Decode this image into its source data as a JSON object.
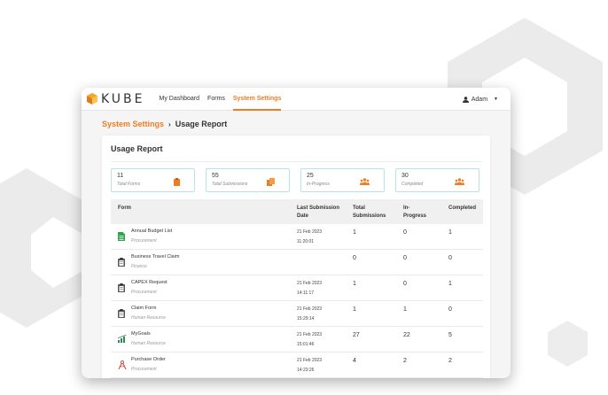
{
  "colors": {
    "accent": "#ef7c22",
    "hex_bg": "#ededed",
    "stat_border": "#b6e3ea"
  },
  "navbar": {
    "logo_text": "KUBE",
    "items": [
      "My Dashboard",
      "Forms",
      "System Settings"
    ],
    "active_item": "System Settings",
    "user": "Adam"
  },
  "breadcrumb": {
    "parent": "System Settings",
    "separator": "›",
    "current": "Usage Report"
  },
  "report": {
    "title": "Usage Report",
    "stats": [
      {
        "value": "11",
        "label": "Total Forms",
        "icon": "clipboard-icon"
      },
      {
        "value": "55",
        "label": "Total Submissions",
        "icon": "documents-icon"
      },
      {
        "value": "25",
        "label": "In-Progress",
        "icon": "users-icon"
      },
      {
        "value": "30",
        "label": "Completed",
        "icon": "users-icon"
      }
    ],
    "columns": [
      "Form",
      "Last Submission Date",
      "Total Submissions",
      "In-Progress",
      "Completed"
    ],
    "rows": [
      {
        "name": "Annual Budget List",
        "category": "Procurement",
        "date": "21 Feb 2023",
        "time": "11:20:01",
        "total": "1",
        "in_progress": "0",
        "completed": "1",
        "icon": "spreadsheet-icon"
      },
      {
        "name": "Business Travel Claim",
        "category": "Finance",
        "date": "",
        "time": "",
        "total": "0",
        "in_progress": "0",
        "completed": "0",
        "icon": "clipboard-icon"
      },
      {
        "name": "CAPEX Request",
        "category": "Procurement",
        "date": "21 Feb 2023",
        "time": "14:11:17",
        "total": "1",
        "in_progress": "0",
        "completed": "1",
        "icon": "clipboard-icon"
      },
      {
        "name": "Claim Form",
        "category": "Human Resource",
        "date": "21 Feb 2023",
        "time": "15:29:14",
        "total": "1",
        "in_progress": "1",
        "completed": "0",
        "icon": "clipboard-icon"
      },
      {
        "name": "MyGoals",
        "category": "Human Resource",
        "date": "21 Feb 2023",
        "time": "15:01:46",
        "total": "27",
        "in_progress": "22",
        "completed": "5",
        "icon": "growth-chart-icon"
      },
      {
        "name": "Purchase Order",
        "category": "Procurement",
        "date": "21 Feb 2023",
        "time": "14:23:26",
        "total": "4",
        "in_progress": "2",
        "completed": "2",
        "icon": "compass-icon"
      }
    ]
  }
}
